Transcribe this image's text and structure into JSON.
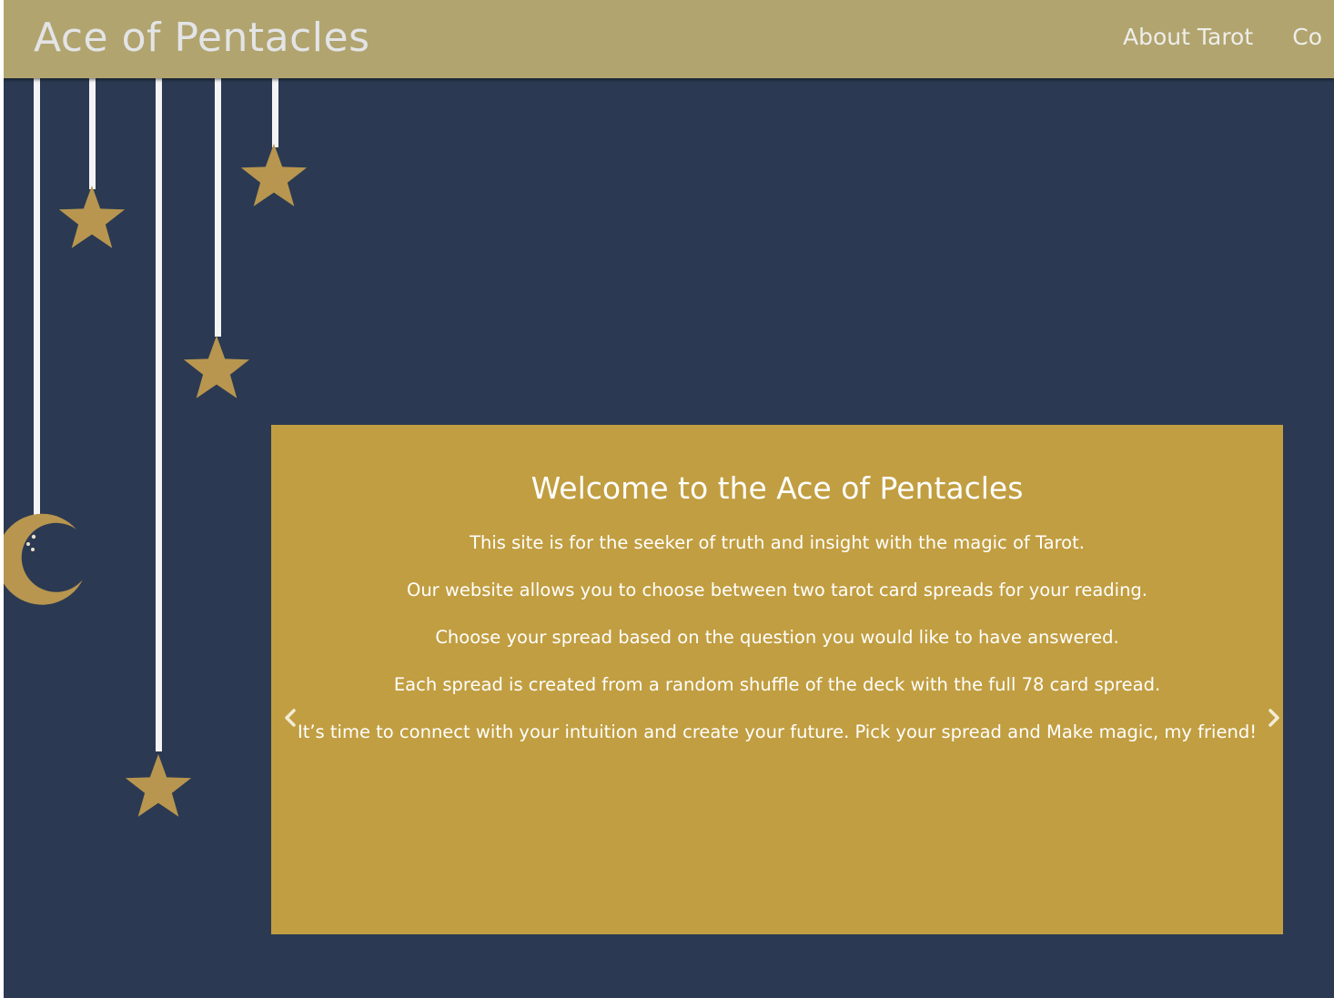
{
  "header": {
    "brand": "Ace of Pentacles",
    "nav": [
      {
        "label": "About Tarot"
      },
      {
        "label": "Co"
      }
    ]
  },
  "colors": {
    "page_background": "#2b3a52",
    "navbar": "#b1a46f",
    "hero_panel": "#c19e41",
    "decoration_gold": "#b8964f"
  },
  "decoration": {
    "icons": [
      "star-icon",
      "moon-icon"
    ]
  },
  "hero": {
    "title": "Welcome to the Ace of Pentacles",
    "paragraphs": [
      "This site is for the seeker of truth and insight with the magic of Tarot.",
      "Our website allows you to choose between two tarot card spreads for your reading.",
      "Choose your spread based on the question you would like to have answered.",
      "Each spread is created from a random shuffle of the deck with the full 78 card spread.",
      "It’s time to connect with your intuition and create your future. Pick your spread and Make magic, my friend!"
    ],
    "prev_icon": "chevron-left-icon",
    "next_icon": "chevron-right-icon"
  }
}
